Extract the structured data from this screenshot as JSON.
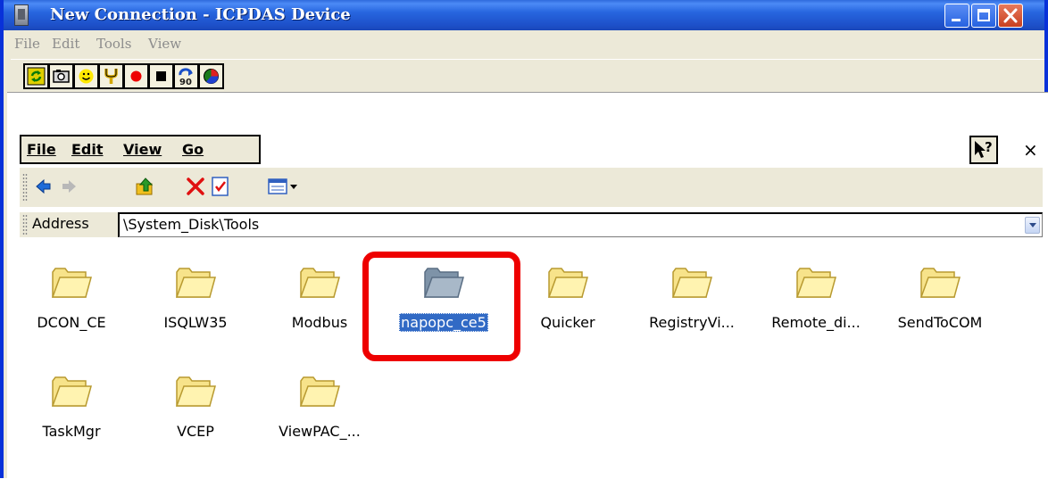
{
  "window": {
    "title": "New Connection - ICPDAS Device",
    "minimize": "minimize",
    "maximize": "maximize",
    "close": "close"
  },
  "host_menu": [
    "File",
    "Edit",
    "Tools",
    "View"
  ],
  "host_toolbar": [
    {
      "icon": "refresh-icon"
    },
    {
      "icon": "screenshot-icon"
    },
    {
      "icon": "smiley-icon"
    },
    {
      "icon": "tools-icon"
    },
    {
      "icon": "record-icon"
    },
    {
      "icon": "stop-icon"
    },
    {
      "icon": "rotate-90-icon"
    },
    {
      "icon": "pie-chart-icon"
    }
  ],
  "ce_menu": [
    "File",
    "Edit",
    "View",
    "Go"
  ],
  "ce_help": "?",
  "ce_close": "×",
  "ce_toolbar": [
    {
      "icon": "back-icon"
    },
    {
      "icon": "forward-icon"
    },
    {
      "icon": "up-folder-icon"
    },
    {
      "icon": "delete-icon"
    },
    {
      "icon": "properties-icon"
    },
    {
      "icon": "views-icon"
    }
  ],
  "address": {
    "label": "Address",
    "value": "\\System_Disk\\Tools"
  },
  "files": [
    {
      "name": "DCON_CE",
      "selected": false
    },
    {
      "name": "ISQLW35",
      "selected": false
    },
    {
      "name": "Modbus",
      "selected": false
    },
    {
      "name": "napopc_ce5",
      "selected": true
    },
    {
      "name": "Quicker",
      "selected": false
    },
    {
      "name": "RegistryVi...",
      "selected": false
    },
    {
      "name": "Remote_di...",
      "selected": false
    },
    {
      "name": "SendToCOM",
      "selected": false
    },
    {
      "name": "TaskMgr",
      "selected": false
    },
    {
      "name": "VCEP",
      "selected": false
    },
    {
      "name": "ViewPAC_...",
      "selected": false
    }
  ],
  "colors": {
    "titlebar": "#245edb",
    "selection": "#316ac5",
    "highlight_frame": "#ee0000",
    "folder_fill": "#f7e38a"
  }
}
